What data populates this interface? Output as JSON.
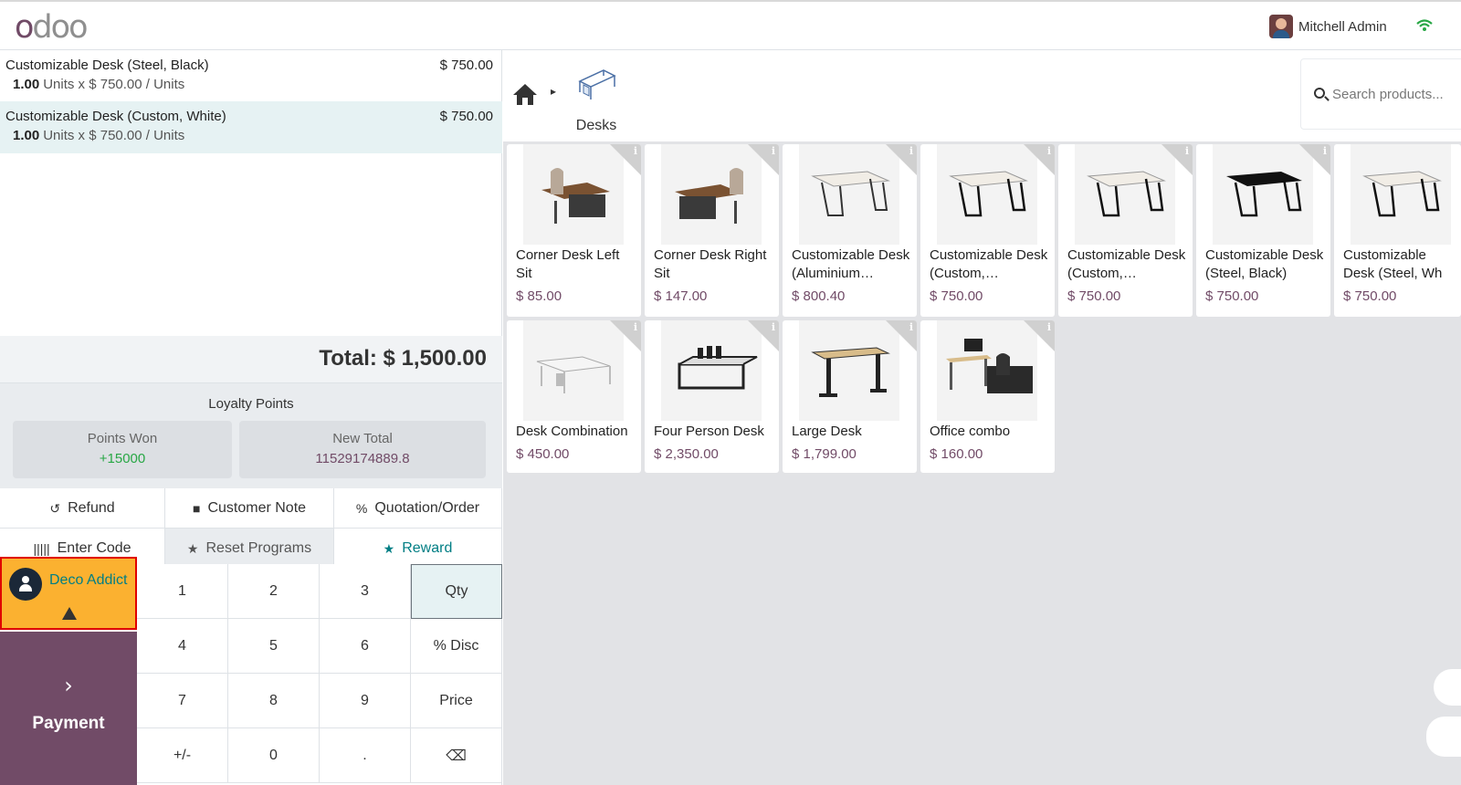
{
  "app": {
    "logo": "odoo",
    "user_name": "Mitchell Admin"
  },
  "order": {
    "lines": [
      {
        "name": "Customizable Desk (Steel, Black)",
        "price": "$ 750.00",
        "qty": "1.00",
        "detail": "Units x $ 750.00 / Units",
        "selected": false
      },
      {
        "name": "Customizable Desk (Custom, White)",
        "price": "$ 750.00",
        "qty": "1.00",
        "detail": "Units x $ 750.00 / Units",
        "selected": true
      }
    ],
    "total": "Total: $ 1,500.00"
  },
  "loyalty": {
    "title": "Loyalty Points",
    "points_won_label": "Points Won",
    "points_won_value": "+15000",
    "new_total_label": "New Total",
    "new_total_value": "11529174889.8"
  },
  "controls": {
    "refund": "Refund",
    "customer_note": "Customer Note",
    "quotation_order": "Quotation/Order",
    "enter_code": "Enter Code",
    "reset_programs": "Reset Programs",
    "reward": "Reward"
  },
  "customer": {
    "name": "Deco Addict"
  },
  "payment": {
    "label": "Payment"
  },
  "numpad": {
    "k1": "1",
    "k2": "2",
    "k3": "3",
    "qty": "Qty",
    "k4": "4",
    "k5": "5",
    "k6": "6",
    "disc": "% Disc",
    "k7": "7",
    "k8": "8",
    "k9": "9",
    "price": "Price",
    "sign": "+/-",
    "k0": "0",
    "dot": ".",
    "back": "⌫"
  },
  "breadcrumb": {
    "category": "Desks"
  },
  "search": {
    "placeholder": "Search products..."
  },
  "products": [
    {
      "name": "Corner Desk Left Sit",
      "price": "$ 85.00",
      "icon": "corner-desk-image"
    },
    {
      "name": "Corner Desk Right Sit",
      "price": "$ 147.00",
      "icon": "corner-desk-image"
    },
    {
      "name": "Customizable Desk (Aluminium…",
      "price": "$ 800.40",
      "icon": "white-desk-image"
    },
    {
      "name": "Customizable Desk (Custom,…",
      "price": "$ 750.00",
      "icon": "white-desk-image"
    },
    {
      "name": "Customizable Desk (Custom,…",
      "price": "$ 750.00",
      "icon": "white-desk-image"
    },
    {
      "name": "Customizable Desk (Steel, Black)",
      "price": "$ 750.00",
      "icon": "black-desk-image"
    },
    {
      "name": "Customizable Desk (Steel, Wh",
      "price": "$ 750.00",
      "icon": "white-desk-image"
    },
    {
      "name": "Desk Combination",
      "price": "$ 450.00",
      "icon": "desk-combination-image"
    },
    {
      "name": "Four Person Desk",
      "price": "$ 2,350.00",
      "icon": "four-person-desk-image"
    },
    {
      "name": "Large Desk",
      "price": "$ 1,799.00",
      "icon": "large-desk-image"
    },
    {
      "name": "Office combo",
      "price": "$ 160.00",
      "icon": "office-combo-image"
    }
  ],
  "colors": {
    "brand": "#714b67",
    "teal": "#017e84",
    "customer_bg": "#fbb130",
    "selected_line": "#e6f2f3"
  }
}
